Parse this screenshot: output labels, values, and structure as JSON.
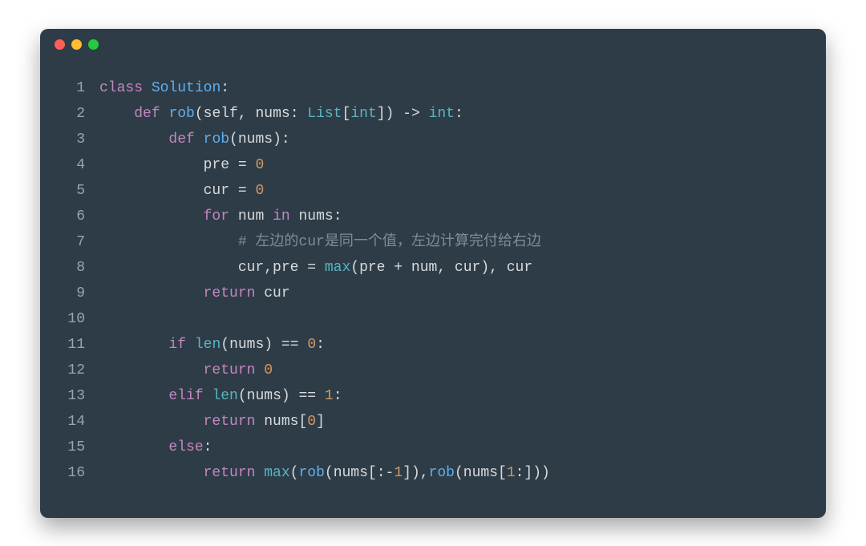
{
  "window": {
    "traffic_lights": [
      "close",
      "minimize",
      "zoom"
    ]
  },
  "code": {
    "lines": [
      {
        "n": "1",
        "indent": 0,
        "tokens": [
          [
            "kw",
            "class"
          ],
          [
            "sp",
            " "
          ],
          [
            "fn",
            "Solution"
          ],
          [
            "punct",
            ":"
          ]
        ]
      },
      {
        "n": "2",
        "indent": 1,
        "tokens": [
          [
            "kw",
            "def"
          ],
          [
            "sp",
            " "
          ],
          [
            "fn",
            "rob"
          ],
          [
            "punct",
            "("
          ],
          [
            "param",
            "self"
          ],
          [
            "punct",
            ", "
          ],
          [
            "param",
            "nums"
          ],
          [
            "punct",
            ": "
          ],
          [
            "builtin",
            "List"
          ],
          [
            "punct",
            "["
          ],
          [
            "typekw",
            "int"
          ],
          [
            "punct",
            "]) -> "
          ],
          [
            "typekw",
            "int"
          ],
          [
            "punct",
            ":"
          ]
        ]
      },
      {
        "n": "3",
        "indent": 2,
        "tokens": [
          [
            "kw",
            "def"
          ],
          [
            "sp",
            " "
          ],
          [
            "fn",
            "rob"
          ],
          [
            "punct",
            "("
          ],
          [
            "param",
            "nums"
          ],
          [
            "punct",
            "):"
          ]
        ]
      },
      {
        "n": "4",
        "indent": 3,
        "tokens": [
          [
            "param",
            "pre"
          ],
          [
            "op",
            " = "
          ],
          [
            "num",
            "0"
          ]
        ]
      },
      {
        "n": "5",
        "indent": 3,
        "tokens": [
          [
            "param",
            "cur"
          ],
          [
            "op",
            " = "
          ],
          [
            "num",
            "0"
          ]
        ]
      },
      {
        "n": "6",
        "indent": 3,
        "tokens": [
          [
            "kw",
            "for"
          ],
          [
            "sp",
            " "
          ],
          [
            "param",
            "num"
          ],
          [
            "sp",
            " "
          ],
          [
            "kw",
            "in"
          ],
          [
            "sp",
            " "
          ],
          [
            "param",
            "nums"
          ],
          [
            "punct",
            ":"
          ]
        ]
      },
      {
        "n": "7",
        "indent": 4,
        "tokens": [
          [
            "comment",
            "# 左边的cur是同一个值，左边计算完付给右边"
          ]
        ]
      },
      {
        "n": "8",
        "indent": 4,
        "tokens": [
          [
            "param",
            "cur"
          ],
          [
            "punct",
            ","
          ],
          [
            "param",
            "pre"
          ],
          [
            "op",
            " = "
          ],
          [
            "builtin",
            "max"
          ],
          [
            "punct",
            "("
          ],
          [
            "param",
            "pre"
          ],
          [
            "op",
            " + "
          ],
          [
            "param",
            "num"
          ],
          [
            "punct",
            ", "
          ],
          [
            "param",
            "cur"
          ],
          [
            "punct",
            "), "
          ],
          [
            "param",
            "cur"
          ]
        ]
      },
      {
        "n": "9",
        "indent": 3,
        "tokens": [
          [
            "kw",
            "return"
          ],
          [
            "sp",
            " "
          ],
          [
            "param",
            "cur"
          ]
        ]
      },
      {
        "n": "10",
        "indent": 0,
        "tokens": []
      },
      {
        "n": "11",
        "indent": 2,
        "tokens": [
          [
            "kw",
            "if"
          ],
          [
            "sp",
            " "
          ],
          [
            "builtin",
            "len"
          ],
          [
            "punct",
            "("
          ],
          [
            "param",
            "nums"
          ],
          [
            "punct",
            ") "
          ],
          [
            "op",
            "=="
          ],
          [
            "sp",
            " "
          ],
          [
            "num",
            "0"
          ],
          [
            "punct",
            ":"
          ]
        ]
      },
      {
        "n": "12",
        "indent": 3,
        "tokens": [
          [
            "kw",
            "return"
          ],
          [
            "sp",
            " "
          ],
          [
            "num",
            "0"
          ]
        ]
      },
      {
        "n": "13",
        "indent": 2,
        "tokens": [
          [
            "kw",
            "elif"
          ],
          [
            "sp",
            " "
          ],
          [
            "builtin",
            "len"
          ],
          [
            "punct",
            "("
          ],
          [
            "param",
            "nums"
          ],
          [
            "punct",
            ") "
          ],
          [
            "op",
            "=="
          ],
          [
            "sp",
            " "
          ],
          [
            "num",
            "1"
          ],
          [
            "punct",
            ":"
          ]
        ]
      },
      {
        "n": "14",
        "indent": 3,
        "tokens": [
          [
            "kw",
            "return"
          ],
          [
            "sp",
            " "
          ],
          [
            "param",
            "nums"
          ],
          [
            "punct",
            "["
          ],
          [
            "num",
            "0"
          ],
          [
            "punct",
            "]"
          ]
        ]
      },
      {
        "n": "15",
        "indent": 2,
        "tokens": [
          [
            "kw",
            "else"
          ],
          [
            "punct",
            ":"
          ]
        ]
      },
      {
        "n": "16",
        "indent": 3,
        "tokens": [
          [
            "kw",
            "return"
          ],
          [
            "sp",
            " "
          ],
          [
            "builtin",
            "max"
          ],
          [
            "punct",
            "("
          ],
          [
            "fn",
            "rob"
          ],
          [
            "punct",
            "("
          ],
          [
            "param",
            "nums"
          ],
          [
            "punct",
            "[:"
          ],
          [
            "op",
            "-"
          ],
          [
            "num",
            "1"
          ],
          [
            "punct",
            "]),"
          ],
          [
            "fn",
            "rob"
          ],
          [
            "punct",
            "("
          ],
          [
            "param",
            "nums"
          ],
          [
            "punct",
            "["
          ],
          [
            "num",
            "1"
          ],
          [
            "punct",
            ":]))"
          ]
        ]
      }
    ],
    "indent_unit": "    "
  }
}
